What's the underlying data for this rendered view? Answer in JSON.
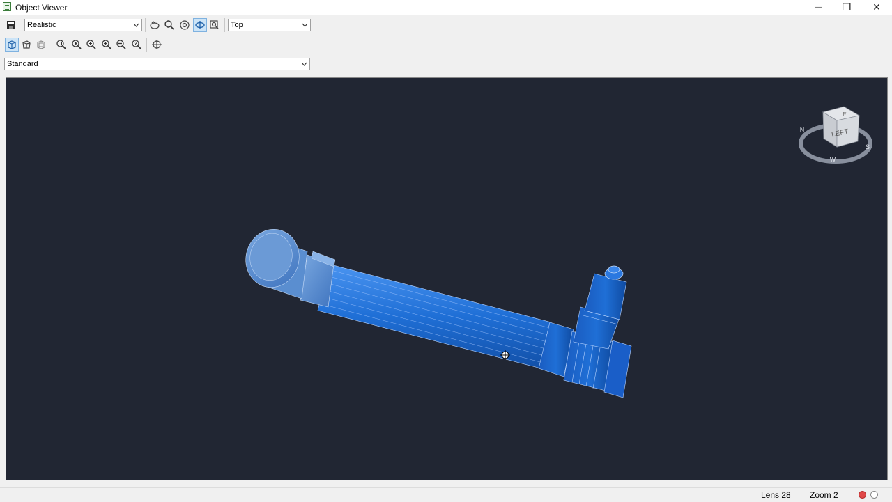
{
  "window": {
    "title": "Object Viewer",
    "minimize_glyph": "—",
    "restore_glyph": "❐",
    "close_glyph": "✕"
  },
  "toolbar": {
    "visual_style": "Realistic",
    "view": "Top",
    "ucs": "Standard"
  },
  "viewcube": {
    "face_label": "LEFT",
    "compass": {
      "n": "N",
      "s": "S",
      "w": "W",
      "e": "E"
    }
  },
  "status": {
    "lens": "Lens 28",
    "zoom": "Zoom 2"
  },
  "colors": {
    "viewport_bg": "#212633",
    "model_blue": "#1f6fd6",
    "model_light": "#5b8fd0",
    "accent_red": "#e04848"
  }
}
